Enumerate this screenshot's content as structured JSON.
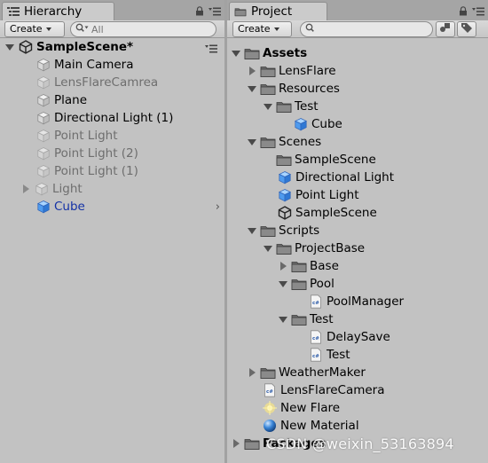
{
  "hierarchy": {
    "tab_title": "Hierarchy",
    "toolbar": {
      "create_label": "Create",
      "search_placeholder": "All"
    },
    "scene": {
      "label": "SampleScene*"
    },
    "items": [
      {
        "label": "Main Camera",
        "state": "enabled"
      },
      {
        "label": "LensFlareCamrea",
        "state": "disabled"
      },
      {
        "label": "Plane",
        "state": "enabled"
      },
      {
        "label": "Directional Light (1)",
        "state": "enabled"
      },
      {
        "label": "Point Light",
        "state": "disabled"
      },
      {
        "label": "Point Light (2)",
        "state": "disabled"
      },
      {
        "label": "Point Light (1)",
        "state": "disabled"
      },
      {
        "label": "Light",
        "state": "disabled"
      },
      {
        "label": "Cube",
        "state": "prefab"
      }
    ]
  },
  "project": {
    "tab_title": "Project",
    "toolbar": {
      "create_label": "Create",
      "search_placeholder": ""
    },
    "tree": {
      "assets": "Assets",
      "lensflare": "LensFlare",
      "resources": "Resources",
      "test": "Test",
      "cube": "Cube",
      "scenes": "Scenes",
      "scenes_samplescene_folder": "SampleScene",
      "directional_light": "Directional Light",
      "point_light": "Point Light",
      "scenes_samplescene": "SampleScene",
      "scripts": "Scripts",
      "projectbase": "ProjectBase",
      "base": "Base",
      "pool": "Pool",
      "poolmanager": "PoolManager",
      "test2": "Test",
      "delaysave": "DelaySave",
      "test_script": "Test",
      "weathermaker": "WeatherMaker",
      "lensflarecamera": "LensFlareCamera",
      "new_flare": "New Flare",
      "new_material": "New Material",
      "packages": "Packages"
    }
  },
  "watermark": "CSDN @weixin_53163894",
  "icons": {
    "lock": "lock-icon",
    "menu": "menu-icon",
    "folder": "folder-icon",
    "gameobject": "gameobject-cube-icon",
    "prefab": "prefab-cube-icon",
    "script": "csharp-script-icon",
    "scene": "unity-scene-icon"
  },
  "colors": {
    "panel_bg": "#c2c2c2",
    "prefab_text": "#1432a6",
    "disabled_text": "#6e6e6e"
  }
}
